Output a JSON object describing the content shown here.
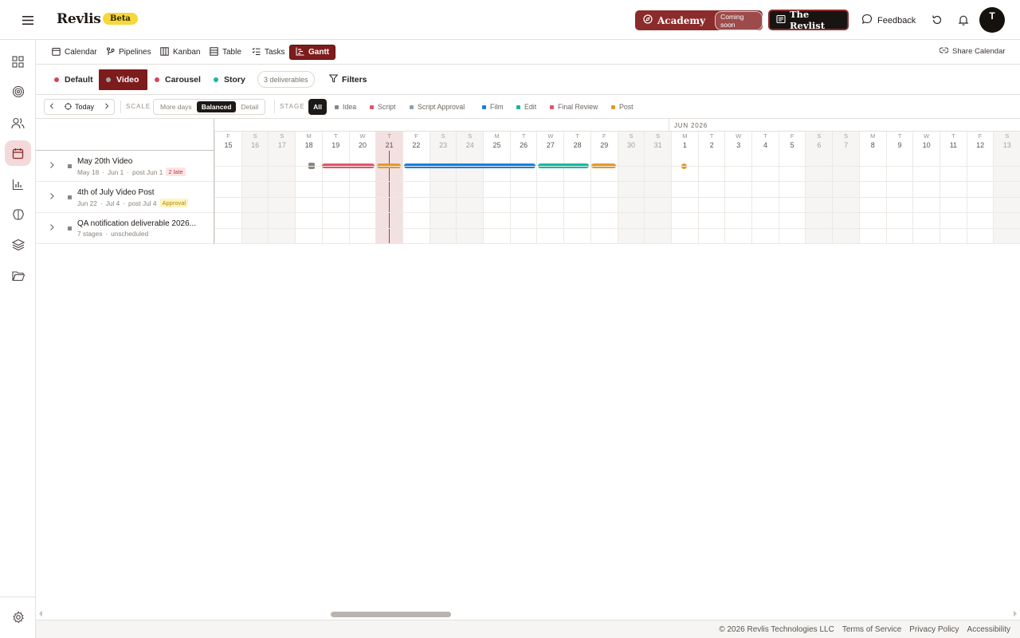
{
  "app": {
    "name": "Revlis",
    "badge": "Beta",
    "academy_label": "Academy",
    "academy_badge": "Coming soon",
    "revlist_label": "The Revlist",
    "feedback_label": "Feedback",
    "avatar_initial": "T"
  },
  "views": {
    "tabs": [
      {
        "label": "Calendar",
        "icon": "calendar-icon"
      },
      {
        "label": "Pipelines",
        "icon": "pipeline-icon"
      },
      {
        "label": "Kanban",
        "icon": "kanban-icon"
      },
      {
        "label": "Table",
        "icon": "table-icon"
      },
      {
        "label": "Tasks",
        "icon": "tasks-icon"
      },
      {
        "label": "Gantt",
        "icon": "gantt-icon",
        "active": true
      }
    ],
    "share_label": "Share Calendar"
  },
  "categories": {
    "items": [
      {
        "label": "Default",
        "color": "#d6455b"
      },
      {
        "label": "Video",
        "color": "#a0a7ad",
        "active": true
      },
      {
        "label": "Carousel",
        "color": "#d6455b"
      },
      {
        "label": "Story",
        "color": "#14b8a6"
      }
    ],
    "deliverables_count": "3 deliverables",
    "filters_label": "Filters"
  },
  "controls": {
    "today_label": "Today",
    "scale_label": "SCALE",
    "scale_options": [
      "More days",
      "Balanced",
      "Detail"
    ],
    "scale_selected": "Balanced",
    "stage_label": "STAGE",
    "stage_all": "All",
    "stages": [
      {
        "label": "Idea",
        "color": "#8c8580"
      },
      {
        "label": "Script",
        "color": "#e0566b"
      },
      {
        "label": "Script Approval",
        "color": "#8fa4ab"
      },
      {
        "label": "Film",
        "color": "#1a7de0"
      },
      {
        "label": "Edit",
        "color": "#14b8a6"
      },
      {
        "label": "Final Review",
        "color": "#e0566b"
      },
      {
        "label": "Post",
        "color": "#e09a2a"
      }
    ]
  },
  "timeline": {
    "month_label": "JUN 2026",
    "today_index": 6,
    "days": [
      {
        "l": "F",
        "d": "15",
        "w": false
      },
      {
        "l": "S",
        "d": "16",
        "w": true
      },
      {
        "l": "S",
        "d": "17",
        "w": true
      },
      {
        "l": "M",
        "d": "18",
        "w": false
      },
      {
        "l": "T",
        "d": "19",
        "w": false
      },
      {
        "l": "W",
        "d": "20",
        "w": false
      },
      {
        "l": "T",
        "d": "21",
        "w": false
      },
      {
        "l": "F",
        "d": "22",
        "w": false
      },
      {
        "l": "S",
        "d": "23",
        "w": true
      },
      {
        "l": "S",
        "d": "24",
        "w": true
      },
      {
        "l": "M",
        "d": "25",
        "w": false
      },
      {
        "l": "T",
        "d": "26",
        "w": false
      },
      {
        "l": "W",
        "d": "27",
        "w": false
      },
      {
        "l": "T",
        "d": "28",
        "w": false
      },
      {
        "l": "F",
        "d": "29",
        "w": false
      },
      {
        "l": "S",
        "d": "30",
        "w": true
      },
      {
        "l": "S",
        "d": "31",
        "w": true
      },
      {
        "l": "M",
        "d": "1",
        "w": false
      },
      {
        "l": "T",
        "d": "2",
        "w": false
      },
      {
        "l": "W",
        "d": "3",
        "w": false
      },
      {
        "l": "T",
        "d": "4",
        "w": false
      },
      {
        "l": "F",
        "d": "5",
        "w": false
      },
      {
        "l": "S",
        "d": "6",
        "w": true
      },
      {
        "l": "S",
        "d": "7",
        "w": true
      },
      {
        "l": "M",
        "d": "8",
        "w": false
      },
      {
        "l": "T",
        "d": "9",
        "w": false
      },
      {
        "l": "W",
        "d": "10",
        "w": false
      },
      {
        "l": "T",
        "d": "11",
        "w": false
      },
      {
        "l": "F",
        "d": "12",
        "w": false
      },
      {
        "l": "S",
        "d": "13",
        "w": true
      }
    ]
  },
  "deliverables": [
    {
      "title": "May 20th Video",
      "sub_a": "May 18",
      "sub_b": "Jun 1",
      "sub_c": "post Jun 1",
      "badge": "2 late",
      "badge_kind": "late",
      "bars": [
        {
          "stage": "Idea",
          "start": 3.5,
          "end": 3.8,
          "color": "#8c8580",
          "shape": "dot"
        },
        {
          "stage": "Script",
          "start": 4.0,
          "end": 5.95,
          "color": "#e0566b"
        },
        {
          "stage": "Script Approval",
          "start": 6.05,
          "end": 6.95,
          "color": "#e09a2a"
        },
        {
          "stage": "Film",
          "start": 7.05,
          "end": 11.95,
          "color": "#1a7de0"
        },
        {
          "stage": "Edit",
          "start": 12.05,
          "end": 13.95,
          "color": "#14b8a6"
        },
        {
          "stage": "Final Review",
          "start": 14.05,
          "end": 14.95,
          "color": "#e09a2a"
        },
        {
          "stage": "Post",
          "start": 17.4,
          "end": 17.6,
          "color": "#e09a2a",
          "shape": "dot"
        }
      ]
    },
    {
      "title": "4th of July Video Post",
      "sub_a": "Jun 22",
      "sub_b": "Jul 4",
      "sub_c": "post Jul 4",
      "badge": "Approval",
      "badge_kind": "approval",
      "bars": []
    },
    {
      "title": "QA notification deliverable 2026...",
      "sub_a": "7 stages",
      "sub_b": "",
      "sub_c": "unscheduled",
      "badge": "",
      "badge_kind": "",
      "bars": []
    }
  ],
  "footer": {
    "copyright": "© 2026 Revlis Technologies LLC",
    "terms": "Terms of Service",
    "privacy": "Privacy Policy",
    "accessibility": "Accessibility"
  }
}
